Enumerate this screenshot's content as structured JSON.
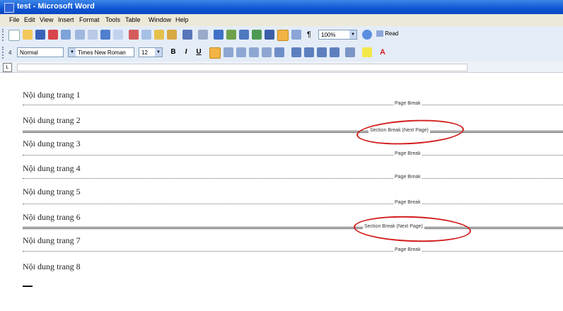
{
  "window": {
    "title": "test - Microsoft Word"
  },
  "menu": [
    "File",
    "Edit",
    "View",
    "Insert",
    "Format",
    "Tools",
    "Table",
    "Window",
    "Help"
  ],
  "toolbar": {
    "zoom": "100%",
    "read_label": "Read"
  },
  "format": {
    "style": "Normal",
    "font": "Times New Roman",
    "size": "12",
    "bold": "B",
    "italic": "I",
    "underline": "U"
  },
  "document": {
    "lines": [
      "Nội dung trang 1",
      "Nội dung trang 2",
      "Nội dung trang 3",
      "Nội dung trang 4",
      "Nội dung trang 5",
      "Nội dung trang 6",
      "Nội dung trang 7",
      "Nội dung trang 8"
    ],
    "page_break": "Page Break",
    "section_break": "Section Break (Next Page)"
  },
  "colors": {
    "title_bar": "#0f55d4",
    "toolbar": "#e4ecf7",
    "annotation": "#d21c1c"
  }
}
